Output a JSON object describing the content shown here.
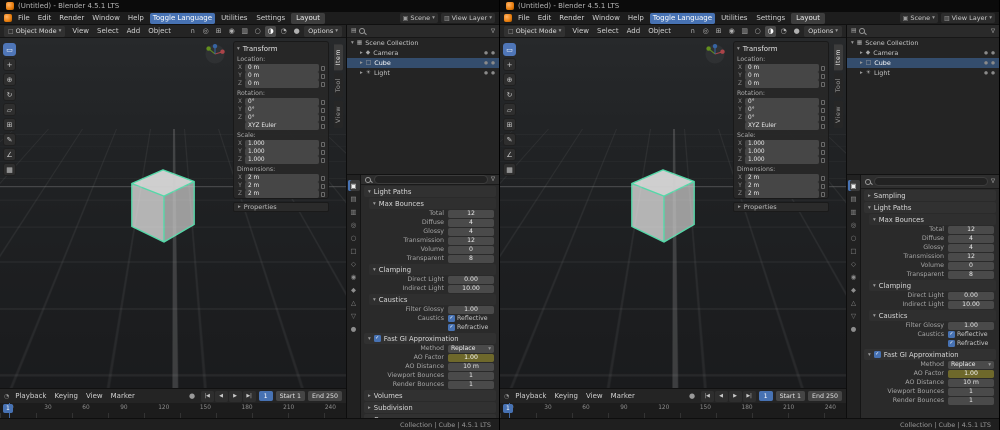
{
  "colors": {
    "accent_blue": "#4772b3",
    "selection_outline": "#54d8a8",
    "keyed_value_field": "#6e682b",
    "blender_orange": "#e87d0d"
  },
  "windows": [
    {
      "title": "(Untitled) - Blender 4.5.1 LTS",
      "menubar": {
        "menus": [
          "File",
          "Edit",
          "Render",
          "Window",
          "Help"
        ],
        "toggle_language": "Toggle Language",
        "utilities": "Utilities",
        "settings": "Settings",
        "workspace": "Layout",
        "scene": "Scene",
        "view_layer": "View Layer"
      },
      "viewport_header": {
        "mode": "Object Mode",
        "menus": [
          "View",
          "Select",
          "Add",
          "Object"
        ],
        "options": "Options"
      },
      "tools": [
        {
          "icon": "tool-select-box-icon",
          "glyph": "▭",
          "active": true
        },
        {
          "icon": "tool-cursor-icon",
          "glyph": "+"
        },
        {
          "icon": "tool-move-icon",
          "glyph": "⊕"
        },
        {
          "icon": "tool-rotate-icon",
          "glyph": "↻"
        },
        {
          "icon": "tool-scale-icon",
          "glyph": "▱"
        },
        {
          "icon": "tool-transform-icon",
          "glyph": "⊞"
        },
        {
          "icon": "tool-annotate-icon",
          "glyph": "✎"
        },
        {
          "icon": "tool-measure-icon",
          "glyph": "∠"
        },
        {
          "icon": "tool-add-cube-icon",
          "glyph": "▦"
        }
      ],
      "npanel": {
        "header": "Transform",
        "groups": [
          {
            "label": "Location:",
            "rows": [
              {
                "axis": "X",
                "value": "0 m"
              },
              {
                "axis": "Y",
                "value": "0 m"
              },
              {
                "axis": "Z",
                "value": "0 m"
              }
            ]
          },
          {
            "label": "Rotation:",
            "rows": [
              {
                "axis": "X",
                "value": "0°"
              },
              {
                "axis": "Y",
                "value": "0°"
              },
              {
                "axis": "Z",
                "value": "0°"
              },
              {
                "axis": "",
                "value": "XYZ Euler"
              }
            ]
          },
          {
            "label": "Scale:",
            "rows": [
              {
                "axis": "X",
                "value": "1.000"
              },
              {
                "axis": "Y",
                "value": "1.000"
              },
              {
                "axis": "Z",
                "value": "1.000"
              }
            ]
          },
          {
            "label": "Dimensions:",
            "rows": [
              {
                "axis": "X",
                "value": "2 m"
              },
              {
                "axis": "Y",
                "value": "2 m"
              },
              {
                "axis": "Z",
                "value": "2 m"
              }
            ]
          }
        ],
        "collapsed": "Properties"
      },
      "npanel_tabs": [
        {
          "label": "Item",
          "active": true
        },
        {
          "label": "Tool"
        },
        {
          "label": "View"
        }
      ],
      "outliner": {
        "root": "Scene Collection",
        "rows": [
          {
            "icon": "camera-icon",
            "glyph": "◆",
            "name": "Camera"
          },
          {
            "icon": "mesh-cube-icon",
            "glyph": "□",
            "name": "Cube",
            "selected": true
          },
          {
            "icon": "light-icon",
            "glyph": "☀",
            "name": "Light"
          }
        ]
      },
      "prop_tabs": [
        {
          "icon": "render-properties-tab-icon",
          "glyph": "▣",
          "active": true
        },
        {
          "icon": "output-properties-tab-icon",
          "glyph": "▤"
        },
        {
          "icon": "view-layer-properties-tab-icon",
          "glyph": "▥"
        },
        {
          "icon": "scene-properties-tab-icon",
          "glyph": "◎"
        },
        {
          "icon": "world-properties-tab-icon",
          "glyph": "○"
        },
        {
          "icon": "object-properties-tab-icon",
          "glyph": "□"
        },
        {
          "icon": "modifier-properties-tab-icon",
          "glyph": "◇"
        },
        {
          "icon": "particles-properties-tab-icon",
          "glyph": "◉"
        },
        {
          "icon": "physics-properties-tab-icon",
          "glyph": "◆"
        },
        {
          "icon": "constraints-properties-tab-icon",
          "glyph": "△"
        },
        {
          "icon": "object-data-properties-tab-icon",
          "glyph": "▽"
        },
        {
          "icon": "material-properties-tab-icon",
          "glyph": "●"
        }
      ],
      "properties": {
        "search_placeholder": "",
        "collapsed_top": [],
        "light_paths": {
          "title": "Light Paths"
        },
        "max_bounces": {
          "title": "Max Bounces",
          "rows": [
            {
              "label": "Total",
              "value": "12"
            },
            {
              "label": "Diffuse",
              "value": "4"
            },
            {
              "label": "Glossy",
              "value": "4"
            },
            {
              "label": "Transmission",
              "value": "12"
            },
            {
              "label": "Volume",
              "value": "0"
            },
            {
              "label": "Transparent",
              "value": "8"
            }
          ]
        },
        "clamping": {
          "title": "Clamping",
          "rows": [
            {
              "label": "Direct Light",
              "value": "0.00"
            },
            {
              "label": "Indirect Light",
              "value": "10.00"
            }
          ]
        },
        "caustics": {
          "title": "Caustics",
          "rows": [
            {
              "label": "Filter Glossy",
              "value": "1.00"
            }
          ],
          "checks_label": "Caustics",
          "checks": [
            {
              "label": "Reflective"
            },
            {
              "label": "Refractive"
            }
          ]
        },
        "fast_gi": {
          "title": "Fast GI Approximation",
          "method_label": "Method",
          "method_value": "Replace",
          "rows": [
            {
              "label": "AO Factor",
              "value": "1.00",
              "keyed": true
            },
            {
              "label": "AO Distance",
              "value": "10 m"
            },
            {
              "label": "Viewport Bounces",
              "value": "1"
            },
            {
              "label": "Render Bounces",
              "value": "1"
            }
          ]
        },
        "collapsed_bottom": [
          "Volumes",
          "Subdivision",
          "Curves"
        ]
      },
      "timeline": {
        "menus": [
          "Playback",
          "Keying",
          "View",
          "Marker"
        ],
        "transport": [
          "|◀",
          "◀",
          "▶",
          "▶|"
        ],
        "current_frame": "1",
        "start_label": "Start",
        "start_value": "1",
        "end_label": "End",
        "end_value": "250",
        "frames": [
          "0",
          "30",
          "60",
          "90",
          "120",
          "150",
          "180",
          "210",
          "240"
        ]
      },
      "status_text": "Collection | Cube | 4.5.1 LTS"
    },
    {
      "title": "(Untitled) - Blender 4.5.1 LTS",
      "menubar": {
        "menus": [
          "File",
          "Edit",
          "Render",
          "Window",
          "Help"
        ],
        "toggle_language": "Toggle Language",
        "utilities": "Utilities",
        "settings": "Settings",
        "workspace": "Layout",
        "scene": "Scene",
        "view_layer": "View Layer"
      },
      "viewport_header": {
        "mode": "Object Mode",
        "menus": [
          "View",
          "Select",
          "Add",
          "Object"
        ],
        "options": "Options"
      },
      "tools": [
        {
          "icon": "tool-select-box-icon",
          "glyph": "▭",
          "active": true
        },
        {
          "icon": "tool-cursor-icon",
          "glyph": "+"
        },
        {
          "icon": "tool-move-icon",
          "glyph": "⊕"
        },
        {
          "icon": "tool-rotate-icon",
          "glyph": "↻"
        },
        {
          "icon": "tool-scale-icon",
          "glyph": "▱"
        },
        {
          "icon": "tool-transform-icon",
          "glyph": "⊞"
        },
        {
          "icon": "tool-annotate-icon",
          "glyph": "✎"
        },
        {
          "icon": "tool-measure-icon",
          "glyph": "∠"
        },
        {
          "icon": "tool-add-cube-icon",
          "glyph": "▦"
        }
      ],
      "npanel": {
        "header": "Transform",
        "groups": [
          {
            "label": "Location:",
            "rows": [
              {
                "axis": "X",
                "value": "0 m"
              },
              {
                "axis": "Y",
                "value": "0 m"
              },
              {
                "axis": "Z",
                "value": "0 m"
              }
            ]
          },
          {
            "label": "Rotation:",
            "rows": [
              {
                "axis": "X",
                "value": "0°"
              },
              {
                "axis": "Y",
                "value": "0°"
              },
              {
                "axis": "Z",
                "value": "0°"
              },
              {
                "axis": "",
                "value": "XYZ Euler"
              }
            ]
          },
          {
            "label": "Scale:",
            "rows": [
              {
                "axis": "X",
                "value": "1.000"
              },
              {
                "axis": "Y",
                "value": "1.000"
              },
              {
                "axis": "Z",
                "value": "1.000"
              }
            ]
          },
          {
            "label": "Dimensions:",
            "rows": [
              {
                "axis": "X",
                "value": "2 m"
              },
              {
                "axis": "Y",
                "value": "2 m"
              },
              {
                "axis": "Z",
                "value": "2 m"
              }
            ]
          }
        ],
        "collapsed": "Properties"
      },
      "npanel_tabs": [
        {
          "label": "Item",
          "active": true
        },
        {
          "label": "Tool"
        },
        {
          "label": "View"
        }
      ],
      "outliner": {
        "root": "Scene Collection",
        "rows": [
          {
            "icon": "camera-icon",
            "glyph": "◆",
            "name": "Camera"
          },
          {
            "icon": "mesh-cube-icon",
            "glyph": "□",
            "name": "Cube",
            "selected": true
          },
          {
            "icon": "light-icon",
            "glyph": "☀",
            "name": "Light"
          }
        ]
      },
      "prop_tabs": [
        {
          "icon": "render-properties-tab-icon",
          "glyph": "▣",
          "active": true
        },
        {
          "icon": "output-properties-tab-icon",
          "glyph": "▤"
        },
        {
          "icon": "view-layer-properties-tab-icon",
          "glyph": "▥"
        },
        {
          "icon": "scene-properties-tab-icon",
          "glyph": "◎"
        },
        {
          "icon": "world-properties-tab-icon",
          "glyph": "○"
        },
        {
          "icon": "object-properties-tab-icon",
          "glyph": "□"
        },
        {
          "icon": "modifier-properties-tab-icon",
          "glyph": "◇"
        },
        {
          "icon": "particles-properties-tab-icon",
          "glyph": "◉"
        },
        {
          "icon": "physics-properties-tab-icon",
          "glyph": "◆"
        },
        {
          "icon": "constraints-properties-tab-icon",
          "glyph": "△"
        },
        {
          "icon": "object-data-properties-tab-icon",
          "glyph": "▽"
        },
        {
          "icon": "material-properties-tab-icon",
          "glyph": "●"
        }
      ],
      "properties": {
        "search_placeholder": "",
        "collapsed_top": [
          "Sampling"
        ],
        "light_paths": {
          "title": "Light Paths"
        },
        "max_bounces": {
          "title": "Max Bounces",
          "rows": [
            {
              "label": "Total",
              "value": "12"
            },
            {
              "label": "Diffuse",
              "value": "4"
            },
            {
              "label": "Glossy",
              "value": "4"
            },
            {
              "label": "Transmission",
              "value": "12"
            },
            {
              "label": "Volume",
              "value": "0"
            },
            {
              "label": "Transparent",
              "value": "8"
            }
          ]
        },
        "clamping": {
          "title": "Clamping",
          "rows": [
            {
              "label": "Direct Light",
              "value": "0.00"
            },
            {
              "label": "Indirect Light",
              "value": "10.00"
            }
          ]
        },
        "caustics": {
          "title": "Caustics",
          "rows": [
            {
              "label": "Filter Glossy",
              "value": "1.00"
            }
          ],
          "checks_label": "Caustics",
          "checks": [
            {
              "label": "Reflective"
            },
            {
              "label": "Refractive"
            }
          ]
        },
        "fast_gi": {
          "title": "Fast GI Approximation",
          "method_label": "Method",
          "method_value": "Replace",
          "rows": [
            {
              "label": "AO Factor",
              "value": "1.00",
              "keyed": true
            },
            {
              "label": "AO Distance",
              "value": "10 m"
            },
            {
              "label": "Viewport Bounces",
              "value": "1"
            },
            {
              "label": "Render Bounces",
              "value": "1"
            }
          ]
        },
        "collapsed_bottom": []
      },
      "timeline": {
        "menus": [
          "Playback",
          "Keying",
          "View",
          "Marker"
        ],
        "transport": [
          "|◀",
          "◀",
          "▶",
          "▶|"
        ],
        "current_frame": "1",
        "start_label": "Start",
        "start_value": "1",
        "end_label": "End",
        "end_value": "250",
        "frames": [
          "0",
          "30",
          "60",
          "90",
          "120",
          "150",
          "180",
          "210",
          "240"
        ]
      },
      "status_text": "Collection | Cube | 4.5.1 LTS"
    }
  ]
}
